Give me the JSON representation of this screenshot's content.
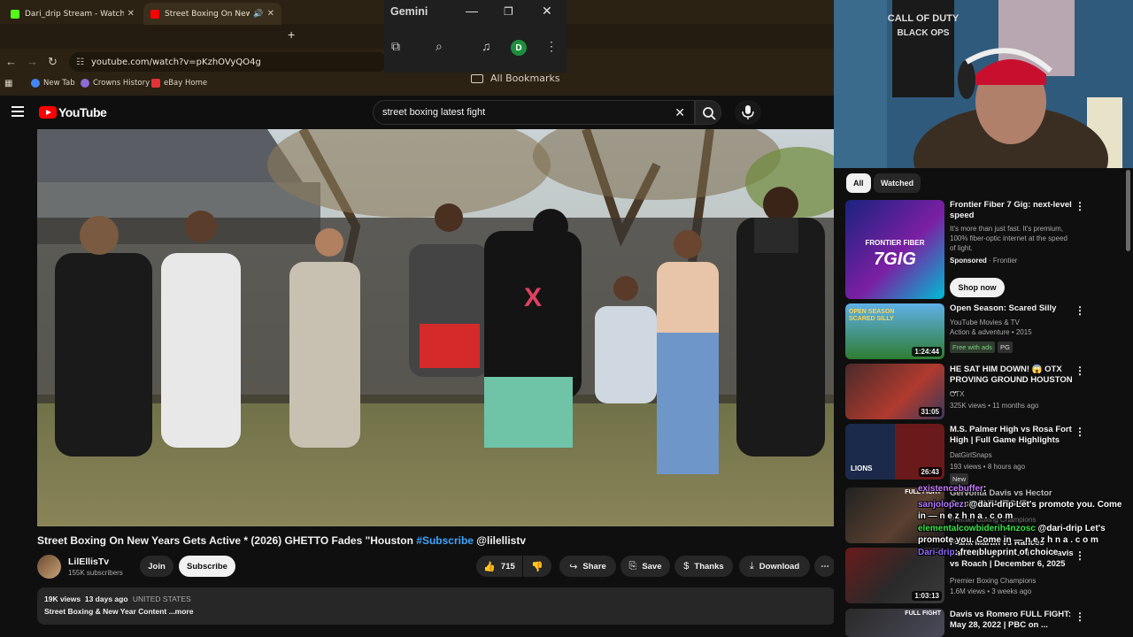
{
  "browser": {
    "tabs": [
      {
        "label": "Dari_drip Stream - Watch Live o",
        "favicon_color": "#53fc18"
      },
      {
        "label": "Street Boxing On New Years G",
        "favicon_color": "#ff0000"
      }
    ],
    "address": "youtube.com/watch?v=pKzhOVyQO4g",
    "bookmarks": [
      {
        "label": "New Tab",
        "color": "#4285f4"
      },
      {
        "label": "Crowns History",
        "color": "#8e6bd6"
      },
      {
        "label": "eBay Home",
        "color": "#e53238"
      }
    ],
    "all_bookmarks": "All Bookmarks"
  },
  "gemini": {
    "title": "Gemini",
    "avatar": "D"
  },
  "youtube": {
    "logo": "YouTube",
    "search_value": "street boxing  latest fight",
    "video": {
      "title_main": "Street Boxing On New Years Gets Active * (2026) GHETTO Fades \"Houston ",
      "title_hashtag": "#Subscribe",
      "title_tail": " @lilellistv",
      "channel": "LilEllisTv",
      "subscribers": "155K subscribers",
      "join": "Join",
      "subscribe": "Subscribe",
      "likes": "715",
      "share": "Share",
      "save": "Save",
      "thanks": "Thanks",
      "download": "Download",
      "views": "19K views",
      "age": "13 days ago",
      "country": "UNITED STATES",
      "description": "Street Boxing & New Year Content ...more"
    },
    "sidebar": {
      "chips": [
        "All",
        "Watched"
      ],
      "ad": {
        "title": "Frontier Fiber 7 Gig: next-level speed",
        "text": "It's more than just fast. It's premium, 100% fiber-optic internet at the speed of light.",
        "sponsored": "Sponsored",
        "advertiser": "Frontier",
        "cta": "Shop now",
        "thumb_line1": "FRONTIER FIBER",
        "thumb_line2": "7GIG"
      },
      "items": [
        {
          "title": "Open Season: Scared Silly",
          "meta1": "YouTube Movies & TV",
          "meta2": "Action & adventure • 2015",
          "badge1": "Free with ads",
          "badge2": "PG",
          "duration": "1:24:44",
          "thumb_text": "OPEN SEASON SCARED SILLY"
        },
        {
          "title": "HE SAT HIM DOWN! 😱 OTX PROVING GROUND HOUSTON ...",
          "meta1": "OTX",
          "meta2": "325K views • 11 months ago",
          "duration": "31:05"
        },
        {
          "title": "M.S. Palmer High vs Rosa Fort High | Full Game Highlights",
          "meta1": "DatGirlSnaps",
          "meta2": "193 views • 8 hours ago",
          "badge1": "New",
          "duration": "26:43",
          "thumb_text": "LIONS"
        },
        {
          "title": "Gervonta Davis vs Hector Garcia FULL FIGHT",
          "meta1": "Premier Boxing Champions",
          "meta2": "",
          "duration": ""
        },
        {
          "title": "Frank Martin vs Rances Barthelemy FULL FIGHT: Davis vs Roach | December 6, 2025",
          "meta1": "Premier Boxing Champions",
          "meta2": "1.6M views • 3 weeks ago",
          "duration": "1:03:13"
        },
        {
          "title": "Davis vs Romero FULL FIGHT: May 28, 2022 | PBC on ...",
          "meta1": "",
          "meta2": "",
          "duration": "",
          "thumb_text": "FULL FIGHT"
        }
      ],
      "thumb_banner": "FULL FIGHT"
    }
  },
  "chat": [
    {
      "user": "existencebuffer",
      "text": ":",
      "color": "#c77dff"
    },
    {
      "user": "sanjolopez",
      "text": "@dari-drip Let's promote you. Come in — n e z h n a . c o m",
      "color": "#b57bff"
    },
    {
      "user": "elementalcowbiderih4nzosc",
      "text": "@dari-drip Let's promote you. Come in — n e z h n a . c o m",
      "color": "#39e44b"
    },
    {
      "user": "Dari-drip",
      "text": "free blueprint of choice",
      "color": "#8f6bff"
    }
  ],
  "webcam": {
    "poster_line1": "CALL OF DUTY",
    "poster_line2": "BLACK OPS"
  }
}
